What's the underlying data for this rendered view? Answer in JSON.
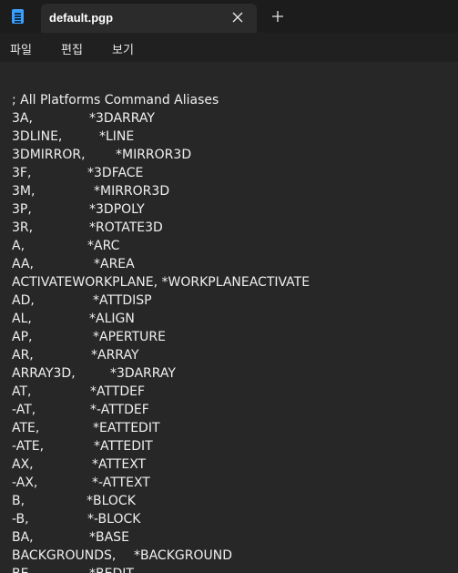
{
  "tab": {
    "title": "default.pgp"
  },
  "menu": {
    "file": "파일",
    "edit": "편집",
    "view": "보기"
  },
  "icons": {
    "app": "notepad-icon",
    "close": "close-icon",
    "new_tab": "plus-icon"
  },
  "colors": {
    "accent": "#3aa0ff",
    "background": "#272727",
    "text": "#f0f0f0"
  },
  "document": {
    "comment": "; All Platforms Command Aliases",
    "lines": [
      {
        "alias": "3A,",
        "command": "*3DARRAY"
      },
      {
        "alias": "3DLINE,",
        "command": "*LINE"
      },
      {
        "alias": "3DMIRROR,",
        "command": "*MIRROR3D"
      },
      {
        "alias": "3F,",
        "command": "*3DFACE"
      },
      {
        "alias": "3M,",
        "command": "*MIRROR3D"
      },
      {
        "alias": "3P,",
        "command": "*3DPOLY"
      },
      {
        "alias": "3R,",
        "command": "*ROTATE3D"
      },
      {
        "alias": "A,",
        "command": "*ARC"
      },
      {
        "alias": "AA,",
        "command": "*AREA"
      },
      {
        "alias": "ACTIVATEWORKPLANE, *WORKPLANEACTIVATE",
        "command": ""
      },
      {
        "alias": "AD,",
        "command": "*ATTDISP"
      },
      {
        "alias": "AL,",
        "command": "*ALIGN"
      },
      {
        "alias": "AP,",
        "command": "*APERTURE"
      },
      {
        "alias": "AR,",
        "command": "*ARRAY"
      },
      {
        "alias": "ARRAY3D,",
        "command": "*3DARRAY"
      },
      {
        "alias": "AT,",
        "command": "*ATTDEF"
      },
      {
        "alias": "-AT,",
        "command": "*-ATTDEF"
      },
      {
        "alias": "ATE,",
        "command": "*EATTEDIT"
      },
      {
        "alias": "-ATE,",
        "command": "*ATTEDIT"
      },
      {
        "alias": "AX,",
        "command": "*ATTEXT"
      },
      {
        "alias": "-AX,",
        "command": "*-ATTEXT"
      },
      {
        "alias": "B,",
        "command": "*BLOCK"
      },
      {
        "alias": "-B,",
        "command": "*-BLOCK"
      },
      {
        "alias": "BA,",
        "command": "*BASE"
      },
      {
        "alias": "BACKGROUNDS,",
        "command": "*BACKGROUND"
      },
      {
        "alias": "BE,",
        "command": "*BEDIT"
      }
    ]
  }
}
